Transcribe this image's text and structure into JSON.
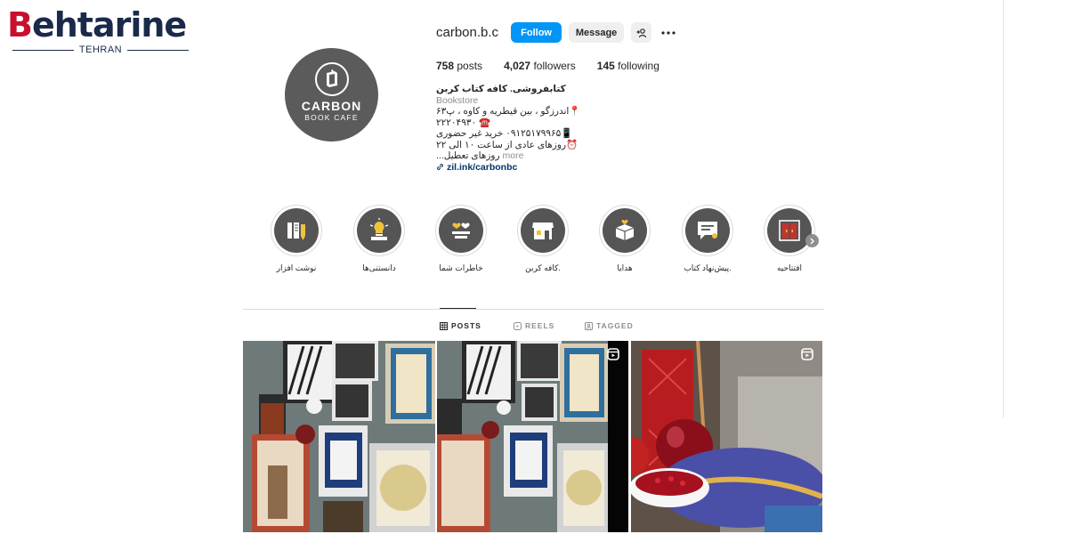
{
  "watermark": {
    "word_first": "B",
    "word_rest": "ehtarine",
    "city": "TEHRAN"
  },
  "profile": {
    "username": "carbon.b.c",
    "follow_label": "Follow",
    "message_label": "Message",
    "avatar_line1": "CARBON",
    "avatar_line2": "BOOK CAFE",
    "stats": {
      "posts_count": "758",
      "posts_label": "posts",
      "followers_count": "4,027",
      "followers_label": "followers",
      "following_count": "145",
      "following_label": "following"
    },
    "bio": {
      "name": "کتابفروشی. کافه کتاب کربن",
      "category": "Bookstore",
      "line1": "📍اندرزگو ، بین قیطریه و کاوه ، پ۶۳",
      "line2": "☎️ ۲۲۲۰۴۹۳۰",
      "line3": "📱۰۹۱۲۵۱۷۹۹۶۵ خرید غیر حضوری",
      "line4": "⏰روزهای عادی از ساعت ۱۰ الی ۲۲",
      "line5": "روزهای تعطیل...",
      "more": "more",
      "link": "zil.ink/carbonbc"
    }
  },
  "highlights": [
    {
      "label": "افتتاحیه",
      "icon": "door-icon"
    },
    {
      "label": "پیش‌نهاد کتاب.",
      "icon": "chat-book-icon"
    },
    {
      "label": "هدایا",
      "icon": "gift-box-icon"
    },
    {
      "label": "کافه کربن.",
      "icon": "storefront-icon"
    },
    {
      "label": "خاطرات شما",
      "icon": "hearts-icon"
    },
    {
      "label": "دانستنی‌ها",
      "icon": "lightbulb-icon"
    },
    {
      "label": "نوشت افزار",
      "icon": "pencils-icon"
    }
  ],
  "tabs": [
    {
      "label": "POSTS",
      "icon": "grid-icon",
      "active": true
    },
    {
      "label": "REELS",
      "icon": "reels-icon",
      "active": false
    },
    {
      "label": "TAGGED",
      "icon": "tag-icon",
      "active": false
    }
  ],
  "posts": [
    {
      "description": "gallery wall with framed calligraphy",
      "reel": false
    },
    {
      "description": "gallery wall with framed calligraphy",
      "reel": true
    },
    {
      "description": "pomegranate display under glass dome",
      "reel": true
    }
  ],
  "colors": {
    "accent": "#0095f6",
    "highlight_bg": "#555555",
    "avatar_bg": "#5b5b5b"
  }
}
